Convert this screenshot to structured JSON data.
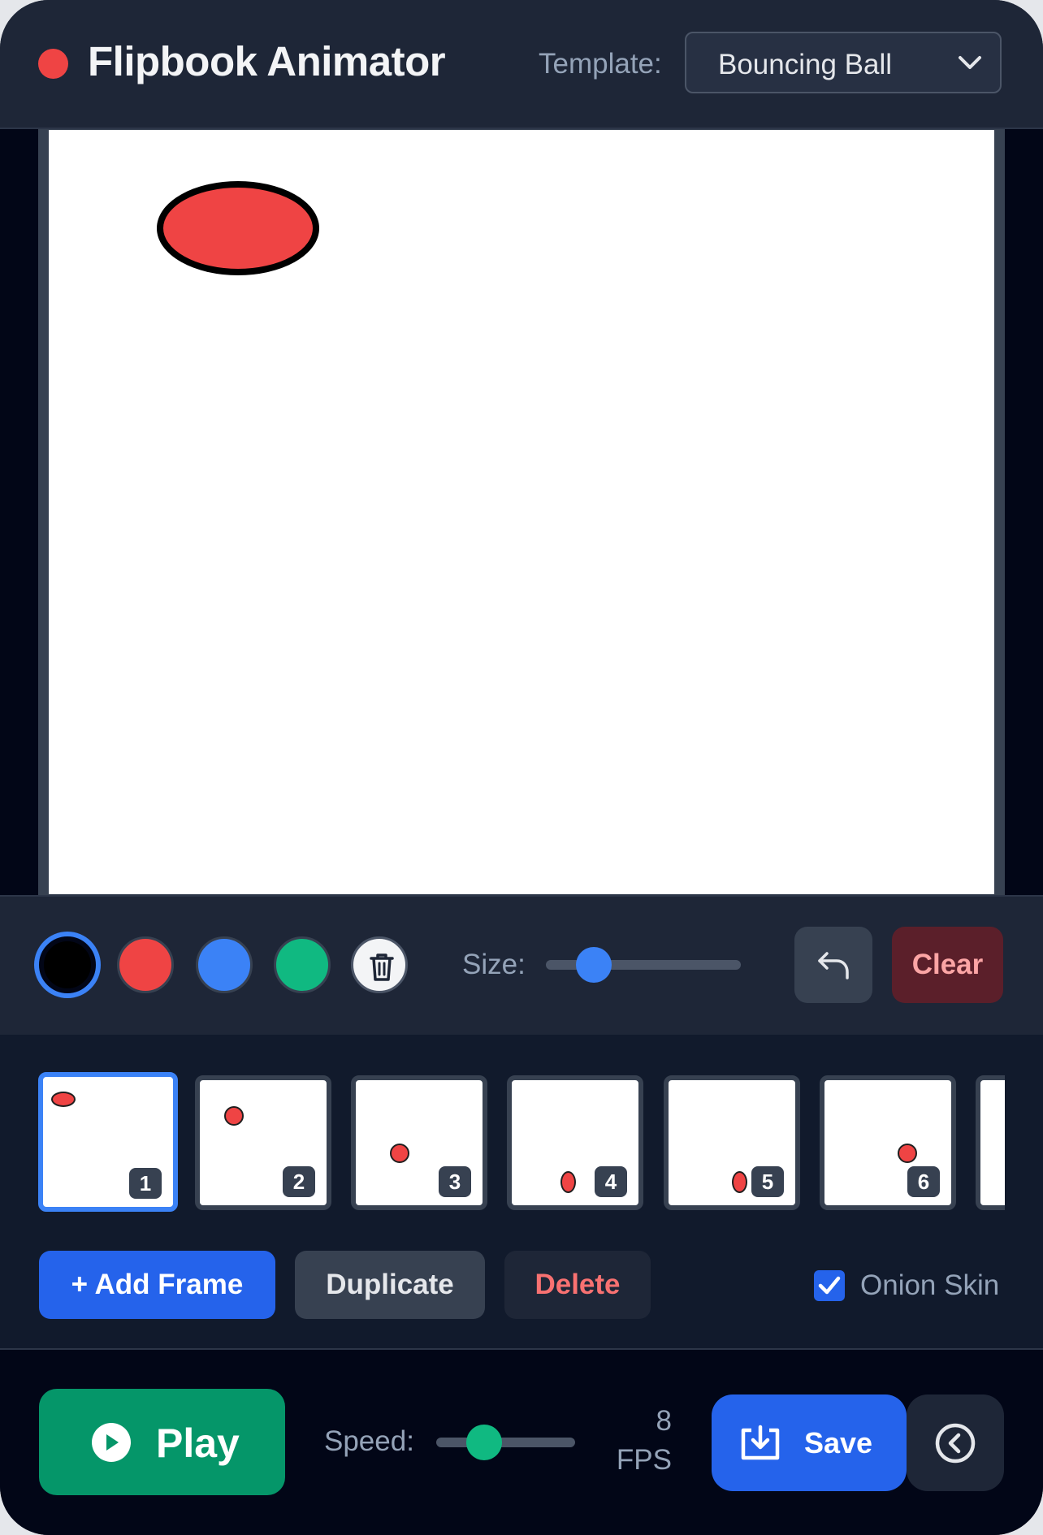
{
  "header": {
    "title": "Flipbook Animator",
    "template_label": "Template:",
    "template_selected": "Bouncing Ball",
    "record_color": "#ef4444"
  },
  "canvas": {
    "background": "#ffffff",
    "ball_color": "#ef4444"
  },
  "toolbar": {
    "swatches": [
      {
        "name": "black",
        "color": "#000000",
        "selected": true
      },
      {
        "name": "red",
        "color": "#ef4444",
        "selected": false
      },
      {
        "name": "blue",
        "color": "#3b82f6",
        "selected": false
      },
      {
        "name": "green",
        "color": "#10b981",
        "selected": false
      }
    ],
    "eraser_icon": "trash-icon",
    "size_label": "Size:",
    "size_value_fraction": 0.25,
    "undo_icon": "undo-icon",
    "clear_label": "Clear"
  },
  "frames": {
    "items": [
      {
        "number": "1",
        "active": true
      },
      {
        "number": "2",
        "active": false
      },
      {
        "number": "3",
        "active": false
      },
      {
        "number": "4",
        "active": false
      },
      {
        "number": "5",
        "active": false
      },
      {
        "number": "6",
        "active": false
      },
      {
        "number": "",
        "active": false
      }
    ],
    "add_label": "+ Add Frame",
    "duplicate_label": "Duplicate",
    "delete_label": "Delete",
    "onion_label": "Onion Skin",
    "onion_checked": true
  },
  "playback": {
    "play_label": "Play",
    "speed_label": "Speed:",
    "fps_value": "8",
    "fps_unit": "FPS",
    "speed_fraction": 0.35,
    "save_label": "Save",
    "accent_green": "#059669",
    "accent_blue": "#2563eb"
  }
}
